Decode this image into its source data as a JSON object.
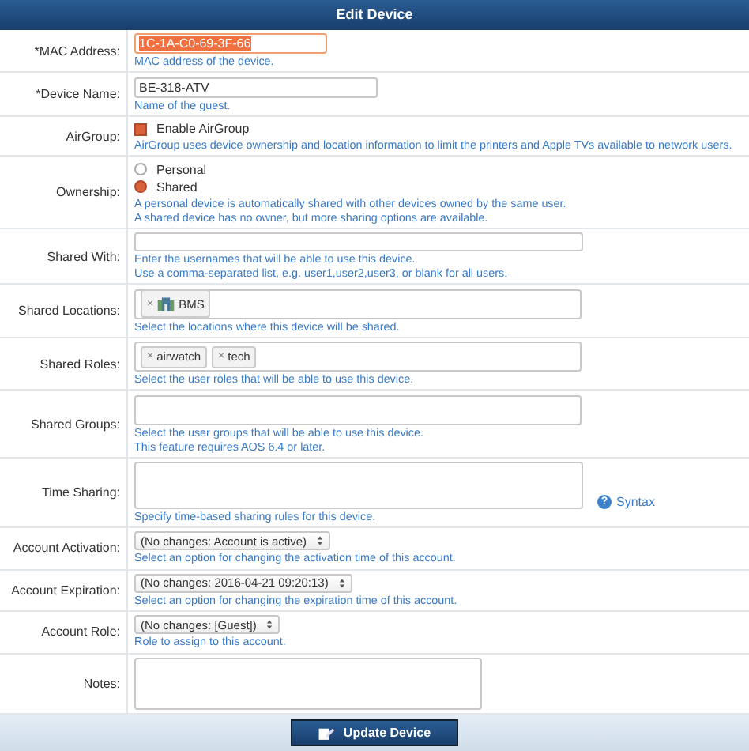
{
  "title": "Edit Device",
  "rows": [
    {
      "kind": "text",
      "required_mark": "*",
      "label": "MAC Address:",
      "value": "1C-1A-C0-69-3F-66",
      "focused": true,
      "hints": [
        "MAC address of the device."
      ]
    },
    {
      "kind": "text",
      "required_mark": "*",
      "label": "Device Name:",
      "value": "BE-318-ATV",
      "focused": false,
      "hints": [
        "Name of the guest."
      ]
    },
    {
      "kind": "checkbox",
      "label": "AirGroup:",
      "option": "Enable AirGroup",
      "checked": true,
      "hints": [
        "AirGroup uses device ownership and location information to limit the printers and Apple TVs available to network users."
      ]
    },
    {
      "kind": "radio",
      "label": "Ownership:",
      "options": [
        {
          "label": "Personal",
          "selected": false
        },
        {
          "label": "Shared",
          "selected": true
        }
      ],
      "hints": [
        "A personal device is automatically shared with other devices owned by the same user.",
        "A shared device has no owner, but more sharing options are available."
      ]
    },
    {
      "kind": "wide",
      "label": "Shared With:",
      "hints": [
        "Enter the usernames that will be able to use this device.",
        "Use a comma-separated list, e.g. user1,user2,user3, or blank for all users."
      ]
    },
    {
      "kind": "tags",
      "label": "Shared Locations:",
      "tags": [
        {
          "remove": "×",
          "label": "BMS",
          "kind": "location"
        }
      ],
      "hints": [
        "Select the locations where this device will be shared."
      ]
    },
    {
      "kind": "tags",
      "label": "Shared Roles:",
      "tags": [
        {
          "remove": "×",
          "label": "airwatch",
          "kind": "role"
        },
        {
          "remove": "×",
          "label": "tech",
          "kind": "role"
        }
      ],
      "hints": [
        "Select the user roles that will be able to use this device."
      ]
    },
    {
      "kind": "tags",
      "label": "Shared Groups:",
      "tags": [],
      "hints": [
        "Select the user groups that will be able to use this device.",
        "This feature requires AOS 6.4 or later."
      ]
    },
    {
      "kind": "textarea",
      "label": "Time Sharing:",
      "help": {
        "mark": "?",
        "label": "Syntax"
      },
      "hints": [
        "Specify time-based sharing rules for this device."
      ]
    },
    {
      "kind": "select",
      "label": "Account Activation:",
      "value": "(No changes: Account is active)",
      "hints": [
        "Select an option for changing the activation time of this account."
      ]
    },
    {
      "kind": "select",
      "label": "Account Expiration:",
      "value": "(No changes: 2016-04-21 09:20:13)",
      "hints": [
        "Select an option for changing the expiration time of this account."
      ]
    },
    {
      "kind": "select",
      "label": "Account Role:",
      "value": "(No changes: [Guest])",
      "hints": [
        "Role to assign to this account."
      ]
    },
    {
      "kind": "notes",
      "label": "Notes:",
      "hints": []
    }
  ],
  "submit": "Update Device"
}
